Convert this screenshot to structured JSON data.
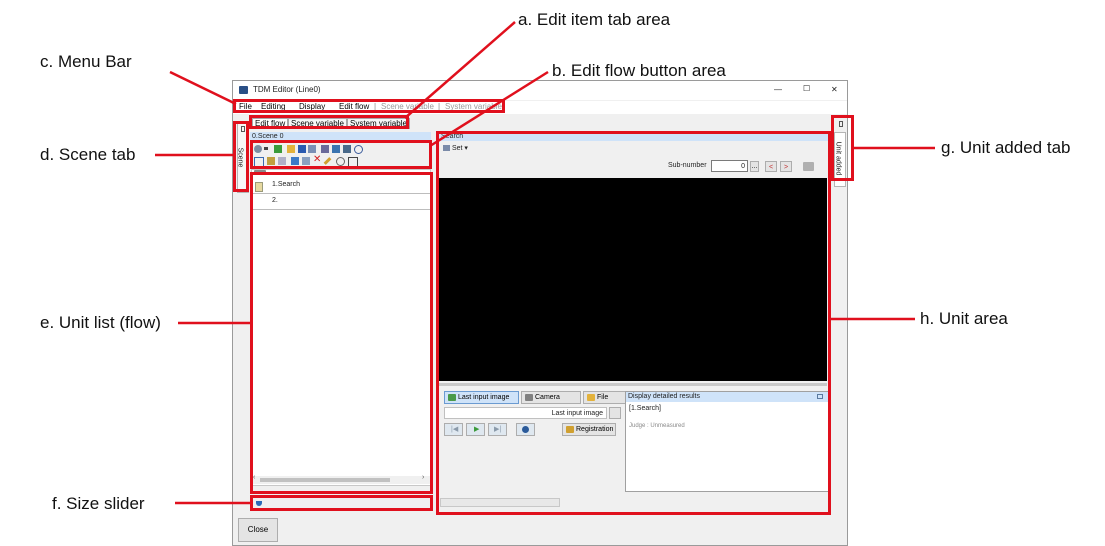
{
  "callouts": {
    "a": "a. Edit item tab area",
    "b": "b. Edit flow button area",
    "c": "c. Menu Bar",
    "d": "d. Scene tab",
    "e": "e. Unit list (flow)",
    "f": "f. Size slider",
    "g": "g. Unit added tab",
    "h": "h. Unit area"
  },
  "colors": {
    "callout_red": "#e0101d",
    "selection_blue": "#cfe3f9",
    "viewer_black": "#000000"
  },
  "window": {
    "title": "TDM Editor (Line0)",
    "controls": {
      "minimize": "—",
      "maximize": "☐",
      "close": "✕"
    }
  },
  "menu": {
    "file": "File",
    "editing": "Editing",
    "display": "Display",
    "edit_flow": "Edit flow",
    "sep1": "|",
    "scene_variable": "Scene variable",
    "sep2": "|",
    "system_variable": "System variable"
  },
  "tabs": {
    "edit_flow": "Edit flow",
    "scene_variable": "Scene variable",
    "system_variable": "System variable"
  },
  "scene_tab": {
    "label": "Scene",
    "icon": "pin-icon"
  },
  "scene_header": "0.Scene 0",
  "flow": {
    "units": [
      {
        "label": "1.Search"
      },
      {
        "label": "2."
      }
    ]
  },
  "unit_area": {
    "title": "Search",
    "set_menu": "Set",
    "sub_number_label": "Sub-number",
    "sub_number_value": "0",
    "ellipsis": "...",
    "prev": "<",
    "next": ">"
  },
  "image_panel": {
    "last_input_image": "Last input image",
    "camera": "Camera",
    "file": "File",
    "current_source": "Last input image",
    "registration": "Registration"
  },
  "results": {
    "header": "Display detailed results",
    "unit": "[1.Search]",
    "judge": "Judge : Unmeasured"
  },
  "unit_added_tab": "Unit added",
  "close_button": "Close"
}
